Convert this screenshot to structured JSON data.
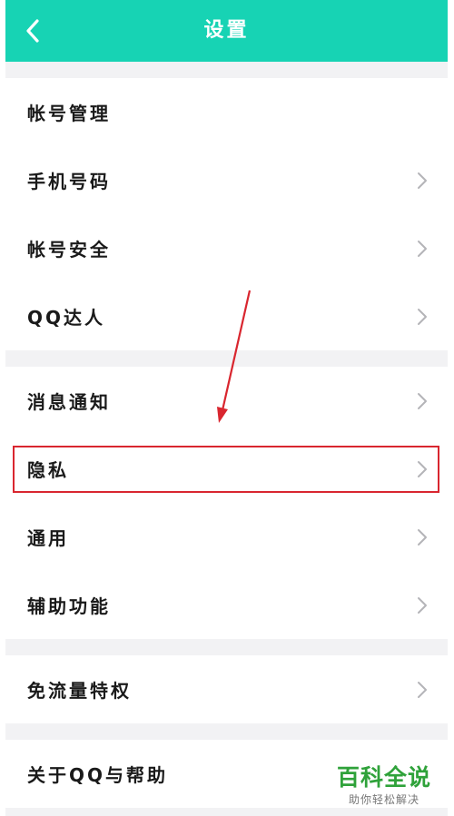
{
  "header": {
    "title": "设置",
    "back_icon": "chevron-left-icon"
  },
  "groups": [
    {
      "items": [
        {
          "label": "帐号管理",
          "chevron": false
        },
        {
          "label": "手机号码",
          "chevron": true
        },
        {
          "label": "帐号安全",
          "chevron": true
        },
        {
          "label": "QQ达人",
          "chevron": true
        }
      ]
    },
    {
      "items": [
        {
          "label": "消息通知",
          "chevron": true
        },
        {
          "label": "隐私",
          "chevron": true,
          "highlighted": true
        },
        {
          "label": "通用",
          "chevron": true
        },
        {
          "label": "辅助功能",
          "chevron": true
        }
      ]
    },
    {
      "items": [
        {
          "label": "免流量特权",
          "chevron": true
        }
      ]
    },
    {
      "items": [
        {
          "label": "关于QQ与帮助",
          "chevron": false
        }
      ]
    }
  ],
  "watermark": {
    "title": "百科全说",
    "subtitle": "助你轻松解决"
  },
  "colors": {
    "header": "#17d3b4",
    "background": "#f2f2f4",
    "annotation": "#d9262f",
    "watermark": "#2fa23a"
  }
}
